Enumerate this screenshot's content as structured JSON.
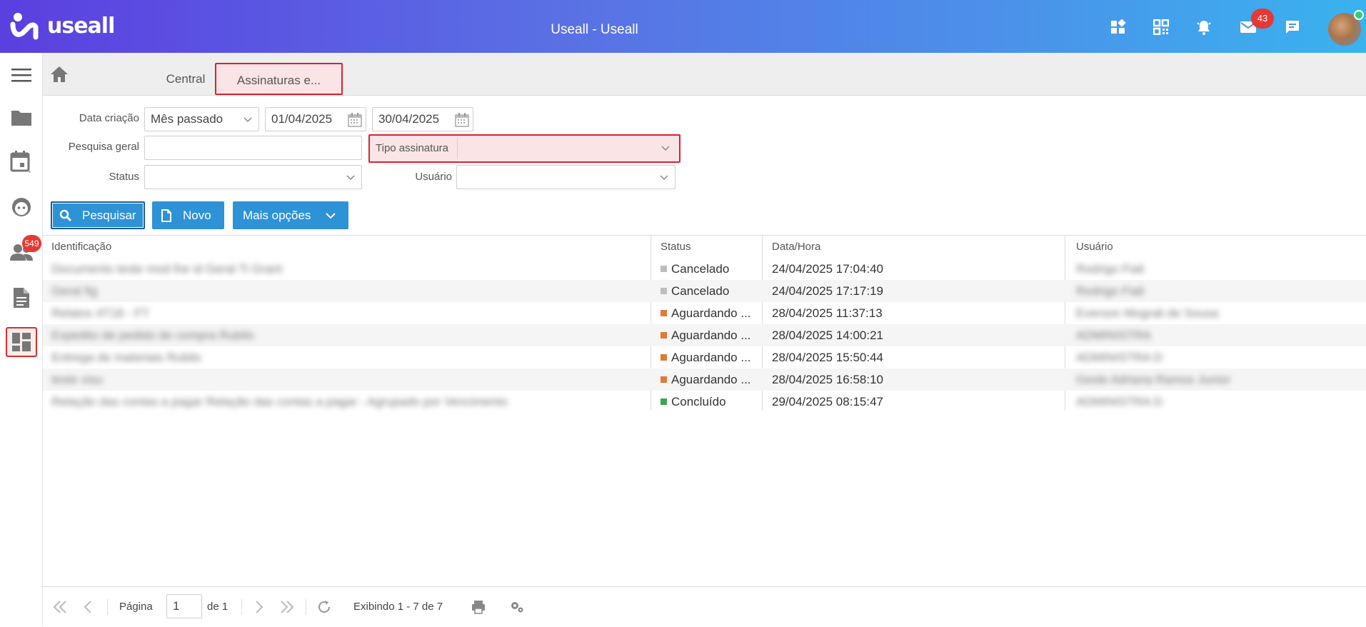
{
  "header": {
    "logo_text": "useall",
    "title": "Useall - Useall",
    "mail_badge": "43"
  },
  "sidebar": {
    "badge_count": "549",
    "items": [
      "menu-icon",
      "folder-icon",
      "calendar-icon",
      "face-icon",
      "people-icon",
      "document-icon",
      "dashboard-icon"
    ]
  },
  "tabs": {
    "central": "Central",
    "active": "Assinaturas e..."
  },
  "filters": {
    "data_criacao_label": "Data criação",
    "period_value": "Mês passado",
    "date_from": "01/04/2025",
    "date_to": "30/04/2025",
    "pesquisa_label": "Pesquisa geral",
    "pesquisa_value": "",
    "tipo_label": "Tipo assinatura",
    "status_label": "Status",
    "usuario_label": "Usuário"
  },
  "buttons": {
    "pesquisar": "Pesquisar",
    "novo": "Novo",
    "mais_opcoes": "Mais opções"
  },
  "table": {
    "headers": {
      "identificacao": "Identificação",
      "status": "Status",
      "data_hora": "Data/Hora",
      "usuario": "Usuário"
    },
    "rows": [
      {
        "id": "Documento teste mod lhe id Geral Ti Grant",
        "status": "Cancelado",
        "status_color": "#bdbdbd",
        "data": "24/04/2025 17:04:40",
        "usuario": "Rodrigo Fiali"
      },
      {
        "id": "Geral fig",
        "status": "Cancelado",
        "status_color": "#bdbdbd",
        "data": "24/04/2025 17:17:19",
        "usuario": "Rodrigo Fiali"
      },
      {
        "id": "Relatos 4T18 - FT",
        "status": "Aguardando ...",
        "status_color": "#e07b39",
        "data": "28/04/2025 11:37:13",
        "usuario": "Everson Mograli de Sousa"
      },
      {
        "id": "Expedito de pedido de compra Rubilo",
        "status": "Aguardando ...",
        "status_color": "#e07b39",
        "data": "28/04/2025 14:00:21",
        "usuario": "ADMINISTRA"
      },
      {
        "id": "Entrega de materiais Rubilo",
        "status": "Aguardando ...",
        "status_color": "#e07b39",
        "data": "28/04/2025 15:50:44",
        "usuario": "ADMINISTRA D"
      },
      {
        "id": "teste visu",
        "status": "Aguardando ...",
        "status_color": "#e07b39",
        "data": "28/04/2025 16:58:10",
        "usuario": "Gesle Adriana Ramos Junior"
      },
      {
        "id": "Relação das contas a pagar Relação das contas a pagar - Agrupado por Vencimento",
        "status": "Concluído",
        "status_color": "#3aa655",
        "data": "29/04/2025 08:15:47",
        "usuario": "ADMINISTRA D"
      }
    ]
  },
  "pager": {
    "pagina_label": "Página",
    "page_value": "1",
    "de_label": "de 1",
    "exibindo": "Exibindo 1 - 7 de 7"
  }
}
